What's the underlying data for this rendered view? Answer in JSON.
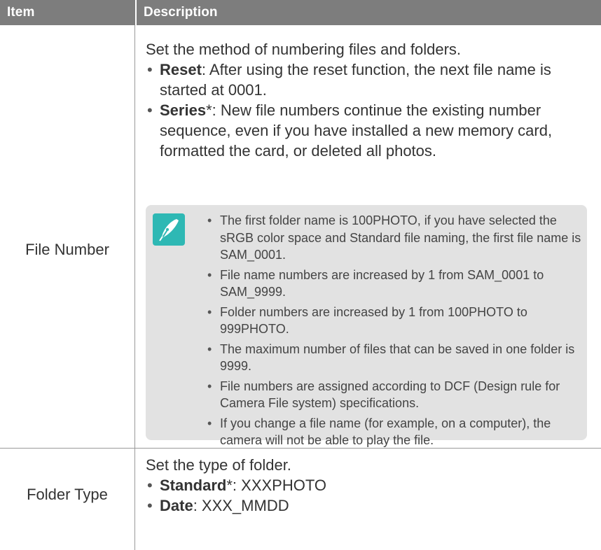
{
  "table": {
    "headers": {
      "item": "Item",
      "description": "Description"
    },
    "rows": [
      {
        "item": "File Number",
        "intro": "Set the method of numbering files and folders.",
        "options": [
          {
            "term": "Reset",
            "text": ": After using the reset function, the next file name is started at 0001."
          },
          {
            "term": "Series",
            "mark": "*",
            "text": ": New file numbers continue the existing number sequence, even if you have installed a new memory card, formatted the card, or deleted all photos."
          }
        ],
        "note": {
          "icon": "note-pen-icon",
          "items": [
            "The first folder name is 100PHOTO, if you have selected the sRGB color space and Standard file naming, the first file name is SAM_0001.",
            "File name numbers are increased by 1 from SAM_0001 to SAM_9999.",
            "Folder numbers are increased by 1 from 100PHOTO to 999PHOTO.",
            "The maximum number of files that can be saved in one folder is 9999.",
            "File numbers are assigned according to DCF (Design rule for Camera File system) specifications.",
            "If you change a file name (for example, on a computer), the camera will not be able to play the file."
          ]
        }
      },
      {
        "item": "Folder Type",
        "intro": "Set the type of folder.",
        "options": [
          {
            "term": "Standard",
            "mark": "*",
            "text": ": XXXPHOTO"
          },
          {
            "term": "Date",
            "text": ": XXX_MMDD"
          }
        ]
      }
    ]
  },
  "colors": {
    "header_bg": "#7d7d7d",
    "note_bg": "#e2e2e2",
    "note_icon": "#2eb8b4"
  }
}
